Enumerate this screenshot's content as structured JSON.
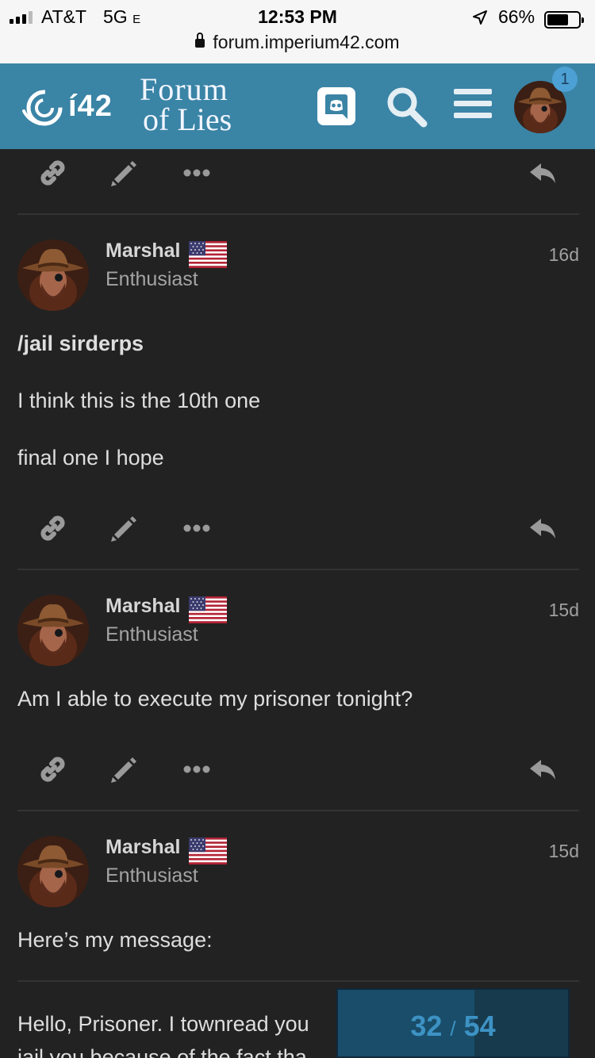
{
  "status_bar": {
    "carrier": "AT&T",
    "network": "5G",
    "network_suffix": "E",
    "time": "12:53 PM",
    "battery": "66%",
    "battery_level": 0.66,
    "url": "forum.imperium42.com"
  },
  "header": {
    "logo_text": "í42",
    "forum_title_line1": "Forum",
    "forum_title_line2": "of Lies",
    "notification_count": "1",
    "icons": [
      "discord-icon",
      "search-icon",
      "hamburger-menu-icon",
      "user-avatar"
    ],
    "colors": {
      "header_bg": "#3a84a6",
      "badge": "#4da0d3"
    }
  },
  "posts": [
    {
      "username": "Marshal",
      "user_title": "Enthusiast",
      "date": "16d",
      "lines": [
        "/jail sirderps",
        "I think this is the 10th one",
        "final one I hope"
      ]
    },
    {
      "username": "Marshal",
      "user_title": "Enthusiast",
      "date": "15d",
      "lines": [
        "Am I able to execute my prisoner tonight?"
      ]
    },
    {
      "username": "Marshal",
      "user_title": "Enthusiast",
      "date": "15d",
      "lines": [
        "Here’s my message:"
      ]
    }
  ],
  "quote_preview": {
    "line1": "Hello, Prisoner. I townread you",
    "line2": "jail you because of the fact tha"
  },
  "progress": {
    "current": "32",
    "separator": "/",
    "total": "54",
    "fraction": 0.593
  }
}
